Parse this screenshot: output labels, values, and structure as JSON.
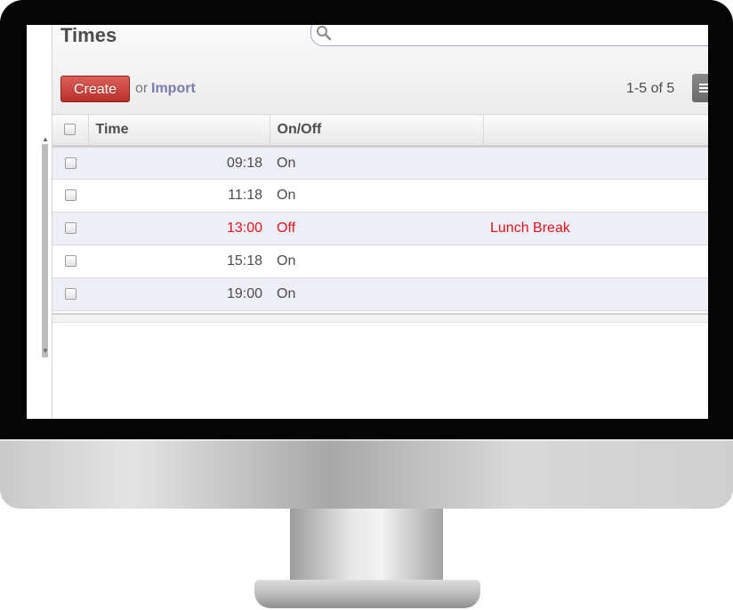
{
  "page": {
    "title": "Times"
  },
  "search": {
    "placeholder": ""
  },
  "toolbar": {
    "create_label": "Create",
    "or_label": "or",
    "import_label": "Import",
    "pager": "1-5 of 5"
  },
  "table": {
    "columns": [
      "Time",
      "On/Off",
      ""
    ],
    "rows": [
      {
        "time": "09:18",
        "state": "On",
        "note": ""
      },
      {
        "time": "11:18",
        "state": "On",
        "note": ""
      },
      {
        "time": "13:00",
        "state": "Off",
        "note": "Lunch Break"
      },
      {
        "time": "15:18",
        "state": "On",
        "note": ""
      },
      {
        "time": "19:00",
        "state": "On",
        "note": ""
      }
    ]
  },
  "icons": {
    "search": "search-icon",
    "list_view": "list-view-icon"
  },
  "colors": {
    "accent_red": "#e0141b",
    "create_button": "#c4403a",
    "import_link": "#7c7bad",
    "row_stripe": "#eeeef6"
  }
}
